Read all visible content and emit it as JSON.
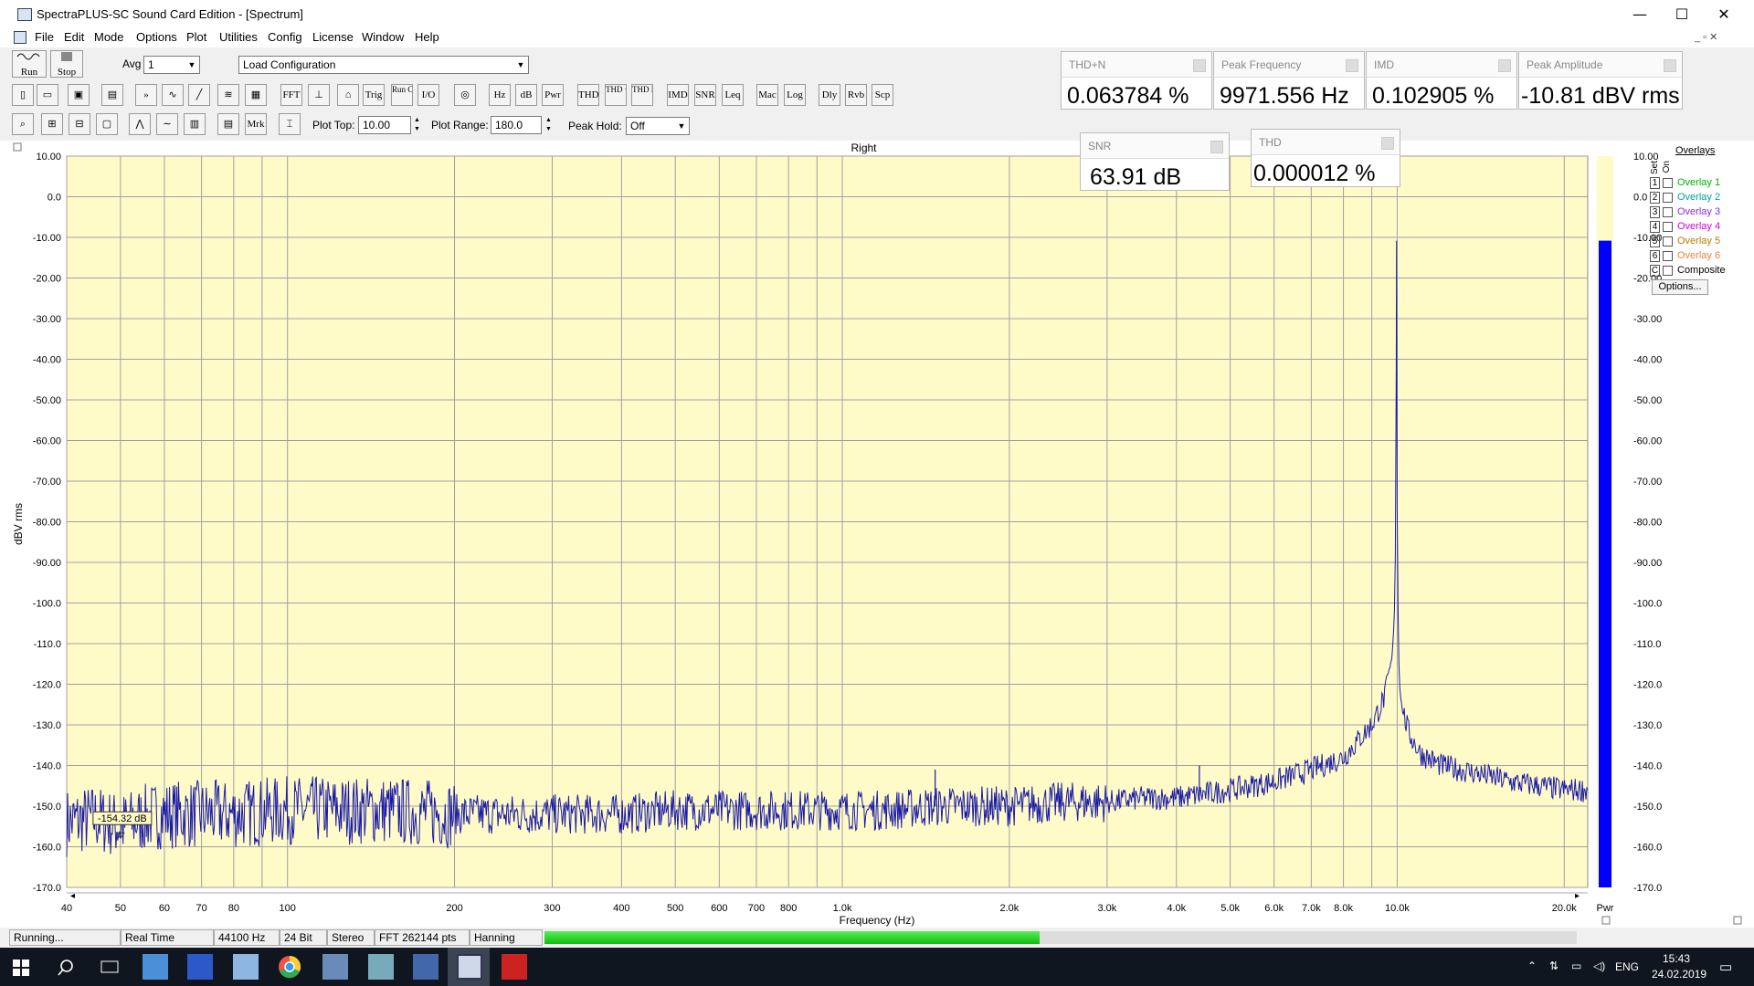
{
  "window": {
    "title": "SpectraPLUS-SC Sound Card Edition - [Spectrum]",
    "minimize": "—",
    "maximize": "☐",
    "close": "✕",
    "mdi_buttons": "_ ▫ ✕"
  },
  "menu": [
    "File",
    "Edit",
    "Mode",
    "Options",
    "Plot",
    "Utilities",
    "Config",
    "License",
    "Window",
    "Help"
  ],
  "toolbar": {
    "run_label": "Run",
    "stop_label": "Stop",
    "avg_label": "Avg",
    "avg_value": "1",
    "config_value": "Load Configuration",
    "buttons_row2": [
      "FFT",
      "Trig",
      "Run Ctrl",
      "I/O",
      "Hz",
      "dB",
      "Pwr",
      "THD",
      "THD +N",
      "THD Freq",
      "IMD",
      "SNR",
      "Leq",
      "Mac",
      "Log",
      "Dly",
      "Rvb",
      "Scp"
    ],
    "buttons_row3": [
      "Mrk"
    ],
    "plot_top_label": "Plot Top:",
    "plot_top_value": "10.00",
    "plot_range_label": "Plot Range:",
    "plot_range_value": "180.0",
    "peak_hold_label": "Peak Hold:",
    "peak_hold_value": "Off"
  },
  "readouts": {
    "thdn": {
      "label": "THD+N",
      "value": "0.063784 %"
    },
    "peak_freq": {
      "label": "Peak Frequency",
      "value": "9971.556 Hz"
    },
    "imd": {
      "label": "IMD",
      "value": "0.102905 %"
    },
    "peak_amp": {
      "label": "Peak Amplitude",
      "value": "-10.81 dBV rms"
    },
    "snr": {
      "label": "SNR",
      "value": "63.91 dB"
    },
    "thd": {
      "label": "THD",
      "value": "0.000012 %"
    }
  },
  "chart_data": {
    "type": "line",
    "title": "Right",
    "xlabel": "Frequency (Hz)",
    "ylabel": "dBV rms",
    "x_scale": "log",
    "xlim": [
      40,
      22050
    ],
    "ylim": [
      -170,
      10
    ],
    "x_ticks": [
      {
        "v": 40,
        "t": "40"
      },
      {
        "v": 50,
        "t": "50"
      },
      {
        "v": 60,
        "t": "60"
      },
      {
        "v": 70,
        "t": "70"
      },
      {
        "v": 80,
        "t": "80"
      },
      {
        "v": 100,
        "t": "100"
      },
      {
        "v": 200,
        "t": "200"
      },
      {
        "v": 300,
        "t": "300"
      },
      {
        "v": 400,
        "t": "400"
      },
      {
        "v": 500,
        "t": "500"
      },
      {
        "v": 600,
        "t": "600"
      },
      {
        "v": 700,
        "t": "700"
      },
      {
        "v": 800,
        "t": "800"
      },
      {
        "v": 1000,
        "t": "1.0k"
      },
      {
        "v": 2000,
        "t": "2.0k"
      },
      {
        "v": 3000,
        "t": "3.0k"
      },
      {
        "v": 4000,
        "t": "4.0k"
      },
      {
        "v": 5000,
        "t": "5.0k"
      },
      {
        "v": 6000,
        "t": "6.0k"
      },
      {
        "v": 7000,
        "t": "7.0k"
      },
      {
        "v": 8000,
        "t": "8.0k"
      },
      {
        "v": 10000,
        "t": "10.0k"
      },
      {
        "v": 20000,
        "t": "20.0k"
      }
    ],
    "y_ticks": [
      10,
      0,
      -10,
      -20,
      -30,
      -40,
      -50,
      -60,
      -70,
      -80,
      -90,
      -100,
      -110,
      -120,
      -130,
      -140,
      -150,
      -160,
      -170
    ],
    "y_tick_labels": [
      "10.00",
      "0.0",
      "-10.00",
      "-20.00",
      "-30.00",
      "-40.00",
      "-50.00",
      "-60.00",
      "-70.00",
      "-80.00",
      "-90.00",
      "-100.0",
      "-110.0",
      "-120.0",
      "-130.0",
      "-140.0",
      "-150.0",
      "-160.0",
      "-170.0"
    ],
    "grid": true,
    "series": [
      {
        "color": "#1a1aa8",
        "x": [
          40,
          45,
          50,
          55,
          60,
          70,
          80,
          100,
          130,
          150,
          200,
          250,
          300,
          400,
          500,
          600,
          800,
          1000,
          1200,
          1500,
          2000,
          2500,
          3000,
          3500,
          4000,
          4500,
          5000,
          6000,
          7000,
          8000,
          9000,
          9500,
          9800,
          9900,
          9950,
          9972,
          10000,
          10050,
          10100,
          10200,
          10500,
          11000,
          12000,
          14000,
          16000,
          18000,
          20000,
          22050
        ],
        "y": [
          -154,
          -153,
          -155,
          -153,
          -152,
          -152,
          -152,
          -151,
          -151,
          -151,
          -152,
          -152,
          -152,
          -152,
          -151,
          -151,
          -151,
          -151,
          -151,
          -150,
          -150,
          -149,
          -149,
          -148,
          -148,
          -147,
          -146,
          -144,
          -141,
          -138,
          -130,
          -123,
          -113,
          -100,
          -75,
          -10.81,
          -80,
          -110,
          -120,
          -126,
          -132,
          -137,
          -140,
          -142,
          -144,
          -145,
          -146,
          -146
        ],
        "noise_db": 5,
        "spurs": [
          {
            "x": 1470,
            "y": -141
          },
          {
            "x": 4400,
            "y": -140
          }
        ]
      }
    ],
    "marker": {
      "x": 50,
      "y": -154.32,
      "label": "-154.32 dB"
    },
    "bar_meter": {
      "label": "Pwr",
      "level_db": -10.81
    }
  },
  "overlays": {
    "title": "Overlays",
    "col_set": "Set",
    "col_on": "On",
    "items": [
      {
        "key": "1",
        "label": "Overlay 1",
        "color": "#00b000"
      },
      {
        "key": "2",
        "label": "Overlay 2",
        "color": "#00a0a0"
      },
      {
        "key": "3",
        "label": "Overlay 3",
        "color": "#8a2be2"
      },
      {
        "key": "4",
        "label": "Overlay 4",
        "color": "#d000d0"
      },
      {
        "key": "5",
        "label": "Overlay 5",
        "color": "#b08000"
      },
      {
        "key": "6",
        "label": "Overlay 6",
        "color": "#f08040"
      },
      {
        "key": "C",
        "label": "Composite",
        "color": "#000000"
      }
    ],
    "options_label": "Options..."
  },
  "status": {
    "state": "Running...",
    "mode": "Real Time",
    "rate": "44100 Hz",
    "bits": "24 Bit",
    "channels": "Stereo",
    "fft": "FFT 262144 pts",
    "window": "Hanning",
    "progress": 0.48
  },
  "taskbar": {
    "lang": "ENG",
    "time": "15:43",
    "date": "24.02.2019"
  },
  "colors": {
    "plot_bg": "#fffbc8",
    "grid": "#a0a0a0",
    "trace": "#1a1aa8",
    "meter": "#0000ff",
    "progress": "#22cc22"
  }
}
